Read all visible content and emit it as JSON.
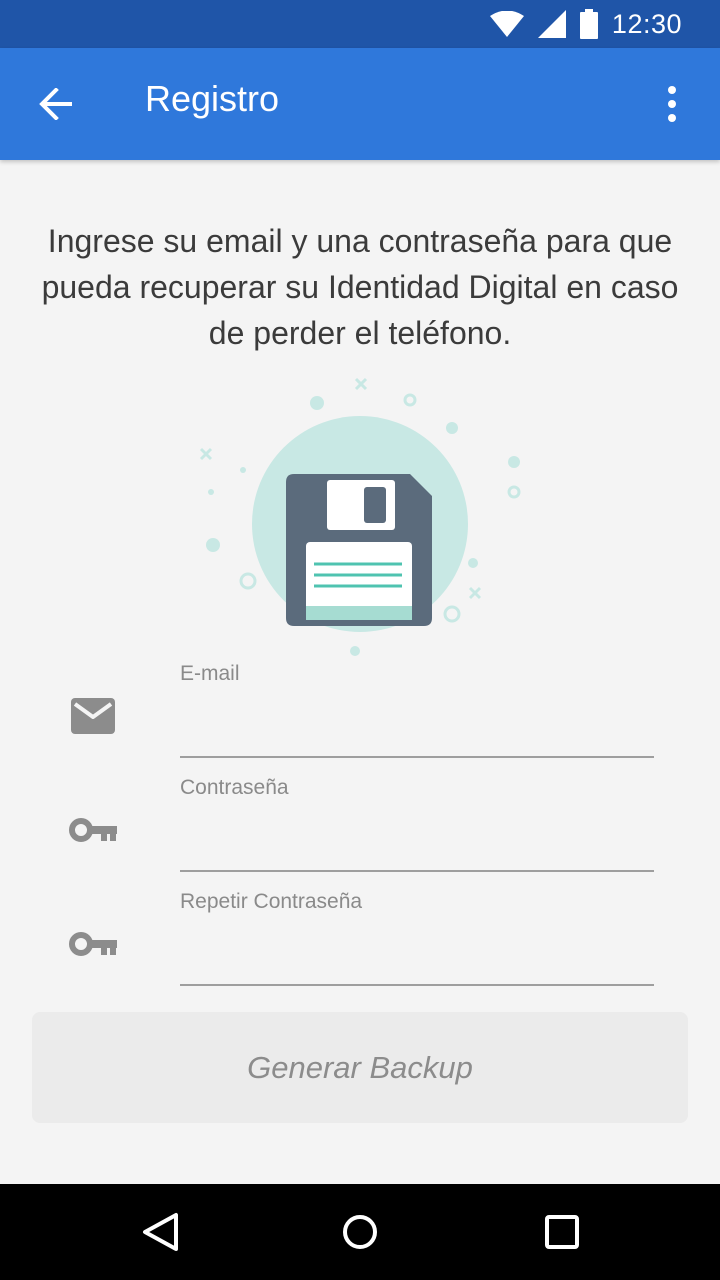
{
  "status_bar": {
    "time": "12:30",
    "icons": [
      "wifi-icon",
      "signal-icon",
      "battery-icon"
    ]
  },
  "app_bar": {
    "title": "Registro",
    "back_icon": "arrow-back-icon",
    "menu_icon": "more-vert-icon",
    "color": "#2f78db"
  },
  "intro_text": "Ingrese su email y una contraseña para que pueda recuperar su Identidad Digital en caso de perder el teléfono.",
  "illustration": "floppy-disk-icon",
  "form": {
    "email": {
      "label": "E-mail",
      "value": "",
      "icon": "mail-icon"
    },
    "password": {
      "label": "Contraseña",
      "value": "",
      "icon": "key-icon"
    },
    "repeat_password": {
      "label": "Repetir Contraseña",
      "value": "",
      "icon": "key-icon"
    }
  },
  "generate_button": {
    "label": "Generar Backup"
  },
  "nav_bar": {
    "icons": [
      "nav-back-icon",
      "nav-home-icon",
      "nav-recents-icon"
    ]
  },
  "colors": {
    "status_bar": "#1f55a8",
    "accent": "#2f78db",
    "floppy": "#5b6b7c",
    "circle": "#c8e8e4",
    "teal": "#4fc3b0"
  }
}
